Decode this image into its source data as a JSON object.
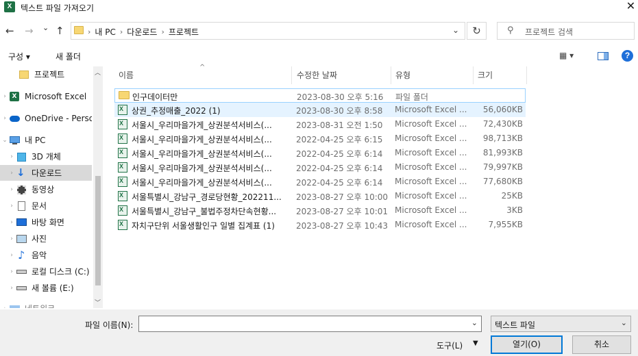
{
  "window": {
    "title": "텍스트 파일 가져오기",
    "close": "✕",
    "app_icon": "X"
  },
  "nav": {
    "back": "←",
    "forward": "→",
    "recent": "⌄",
    "up": "↑",
    "crumbs": [
      "내 PC",
      "다운로드",
      "프로젝트"
    ],
    "refresh": "↻",
    "search_placeholder": "프로젝트 검색"
  },
  "toolbar": {
    "organize": "구성 ▾",
    "new_folder": "새 폴더",
    "view": "▦ ▾",
    "help": "?"
  },
  "sidebar": {
    "items": [
      {
        "label": "프로젝트",
        "icon": "folder-icon",
        "indent": 1
      },
      {
        "label": "Microsoft Excel",
        "icon": "excel-icon",
        "indent": 0
      },
      {
        "label": "OneDrive - Personal",
        "icon": "cloud-icon",
        "indent": 0
      },
      {
        "label": "내 PC",
        "icon": "pc-icon",
        "indent": 0
      },
      {
        "label": "3D 개체",
        "icon": "cube-icon",
        "indent": 1
      },
      {
        "label": "다운로드",
        "icon": "download-icon",
        "indent": 1,
        "selected": true
      },
      {
        "label": "동영상",
        "icon": "video-icon",
        "indent": 1
      },
      {
        "label": "문서",
        "icon": "document-icon",
        "indent": 1
      },
      {
        "label": "바탕 화면",
        "icon": "desktop-icon",
        "indent": 1
      },
      {
        "label": "사진",
        "icon": "picture-icon",
        "indent": 1
      },
      {
        "label": "음악",
        "icon": "music-icon",
        "indent": 1
      },
      {
        "label": "로컬 디스크 (C:)",
        "icon": "drive-icon",
        "indent": 1
      },
      {
        "label": "새 볼륨 (E:)",
        "icon": "drive-icon",
        "indent": 1
      },
      {
        "label": "네트워크",
        "icon": "network-icon",
        "indent": 0
      }
    ]
  },
  "columns": {
    "name": "이름",
    "date": "수정한 날짜",
    "type": "유형",
    "size": "크기"
  },
  "files": [
    {
      "name": "인구데이터만",
      "date": "2023-08-30 오후 5:16",
      "type": "파일 폴더",
      "size": "",
      "kind": "folder"
    },
    {
      "name": "상권_추정매출_2022 (1)",
      "date": "2023-08-30 오후 8:58",
      "type": "Microsoft Excel ...",
      "size": "56,060KB",
      "kind": "excel"
    },
    {
      "name": "서울시_우리마을가게_상권분석서비스(...",
      "date": "2023-08-31 오전 1:50",
      "type": "Microsoft Excel ...",
      "size": "72,430KB",
      "kind": "excel"
    },
    {
      "name": "서울시_우리마을가게_상권분석서비스(...",
      "date": "2022-04-25 오후 6:15",
      "type": "Microsoft Excel ...",
      "size": "98,713KB",
      "kind": "excel"
    },
    {
      "name": "서울시_우리마을가게_상권분석서비스(...",
      "date": "2022-04-25 오후 6:14",
      "type": "Microsoft Excel ...",
      "size": "81,993KB",
      "kind": "excel"
    },
    {
      "name": "서울시_우리마을가게_상권분석서비스(...",
      "date": "2022-04-25 오후 6:14",
      "type": "Microsoft Excel ...",
      "size": "79,997KB",
      "kind": "excel"
    },
    {
      "name": "서울시_우리마을가게_상권분석서비스(...",
      "date": "2022-04-25 오후 6:14",
      "type": "Microsoft Excel ...",
      "size": "77,680KB",
      "kind": "excel"
    },
    {
      "name": "서울특별시_강남구_경로당현황_202211...",
      "date": "2023-08-27 오후 10:00",
      "type": "Microsoft Excel ...",
      "size": "25KB",
      "kind": "excel"
    },
    {
      "name": "서울특별시_강남구_불법주정차단속현황...",
      "date": "2023-08-27 오후 10:01",
      "type": "Microsoft Excel ...",
      "size": "3KB",
      "kind": "excel"
    },
    {
      "name": "자치구단위 서울생활인구 일별 집계표 (1)",
      "date": "2023-08-27 오후 10:43",
      "type": "Microsoft Excel ...",
      "size": "7,955KB",
      "kind": "excel"
    }
  ],
  "bottom": {
    "filename_label": "파일 이름(N):",
    "filename_value": "",
    "filetype": "텍스트 파일",
    "tools": "도구(L)",
    "open": "열기(O)",
    "cancel": "취소"
  }
}
